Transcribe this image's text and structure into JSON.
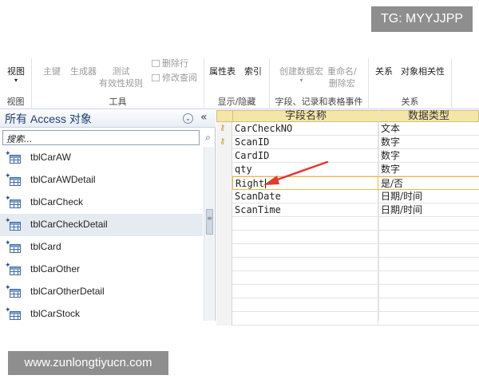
{
  "watermarks": {
    "top": "TG: MYYJJPP",
    "bottom": "www.zunlongtiyucn.com"
  },
  "ribbon": {
    "groups": [
      {
        "label": "视图"
      },
      {
        "label": "工具"
      },
      {
        "label": "显示/隐藏"
      },
      {
        "label": "字段、记录和表格事件"
      },
      {
        "label": "关系"
      }
    ],
    "view_button": "视图",
    "view_arrow": "▾",
    "primary_key": "主键",
    "builder": "生成器",
    "test_rules_line1": "测试",
    "test_rules_line2": "有效性规则",
    "delete_rows": "删除行",
    "modify_lookup": "修改查阅",
    "property_sheet": "属性表",
    "indexes": "索引",
    "create_macro_line1": "创建数据宏",
    "create_macro_line2": "▾",
    "rename_line1": "重命名/",
    "rename_line2": "删除宏",
    "relationships": "关系",
    "object_dependencies": "对象相关性"
  },
  "nav": {
    "title": "所有 Access 对象",
    "dropdown_icon": "⌄",
    "collapse_icon": "«",
    "search_value": "搜索...",
    "search_icon": "⌕",
    "items": [
      {
        "label": "tblCarAW"
      },
      {
        "label": "tblCarAWDetail"
      },
      {
        "label": "tblCarCheck"
      },
      {
        "label": "tblCarCheckDetail"
      },
      {
        "label": "tblCard"
      },
      {
        "label": "tblCarOther"
      },
      {
        "label": "tblCarOtherDetail"
      },
      {
        "label": "tblCarStock"
      }
    ],
    "selected_index": 3
  },
  "design": {
    "headers": {
      "field_name": "字段名称",
      "data_type": "数据类型"
    },
    "rows": [
      {
        "name": "CarCheckNO",
        "type": "文本",
        "key": true
      },
      {
        "name": "ScanID",
        "type": "数字",
        "key": true
      },
      {
        "name": "CardID",
        "type": "数字",
        "key": false
      },
      {
        "name": "qty",
        "type": "数字",
        "key": false
      },
      {
        "name": "Right",
        "type": "是/否",
        "key": false
      },
      {
        "name": "ScanDate",
        "type": "日期/时间",
        "key": false
      },
      {
        "name": "ScanTime",
        "type": "日期/时间",
        "key": false
      }
    ],
    "active_row": 4,
    "accent_color": "#f0b840",
    "arrow_color": "#e03a2f"
  }
}
